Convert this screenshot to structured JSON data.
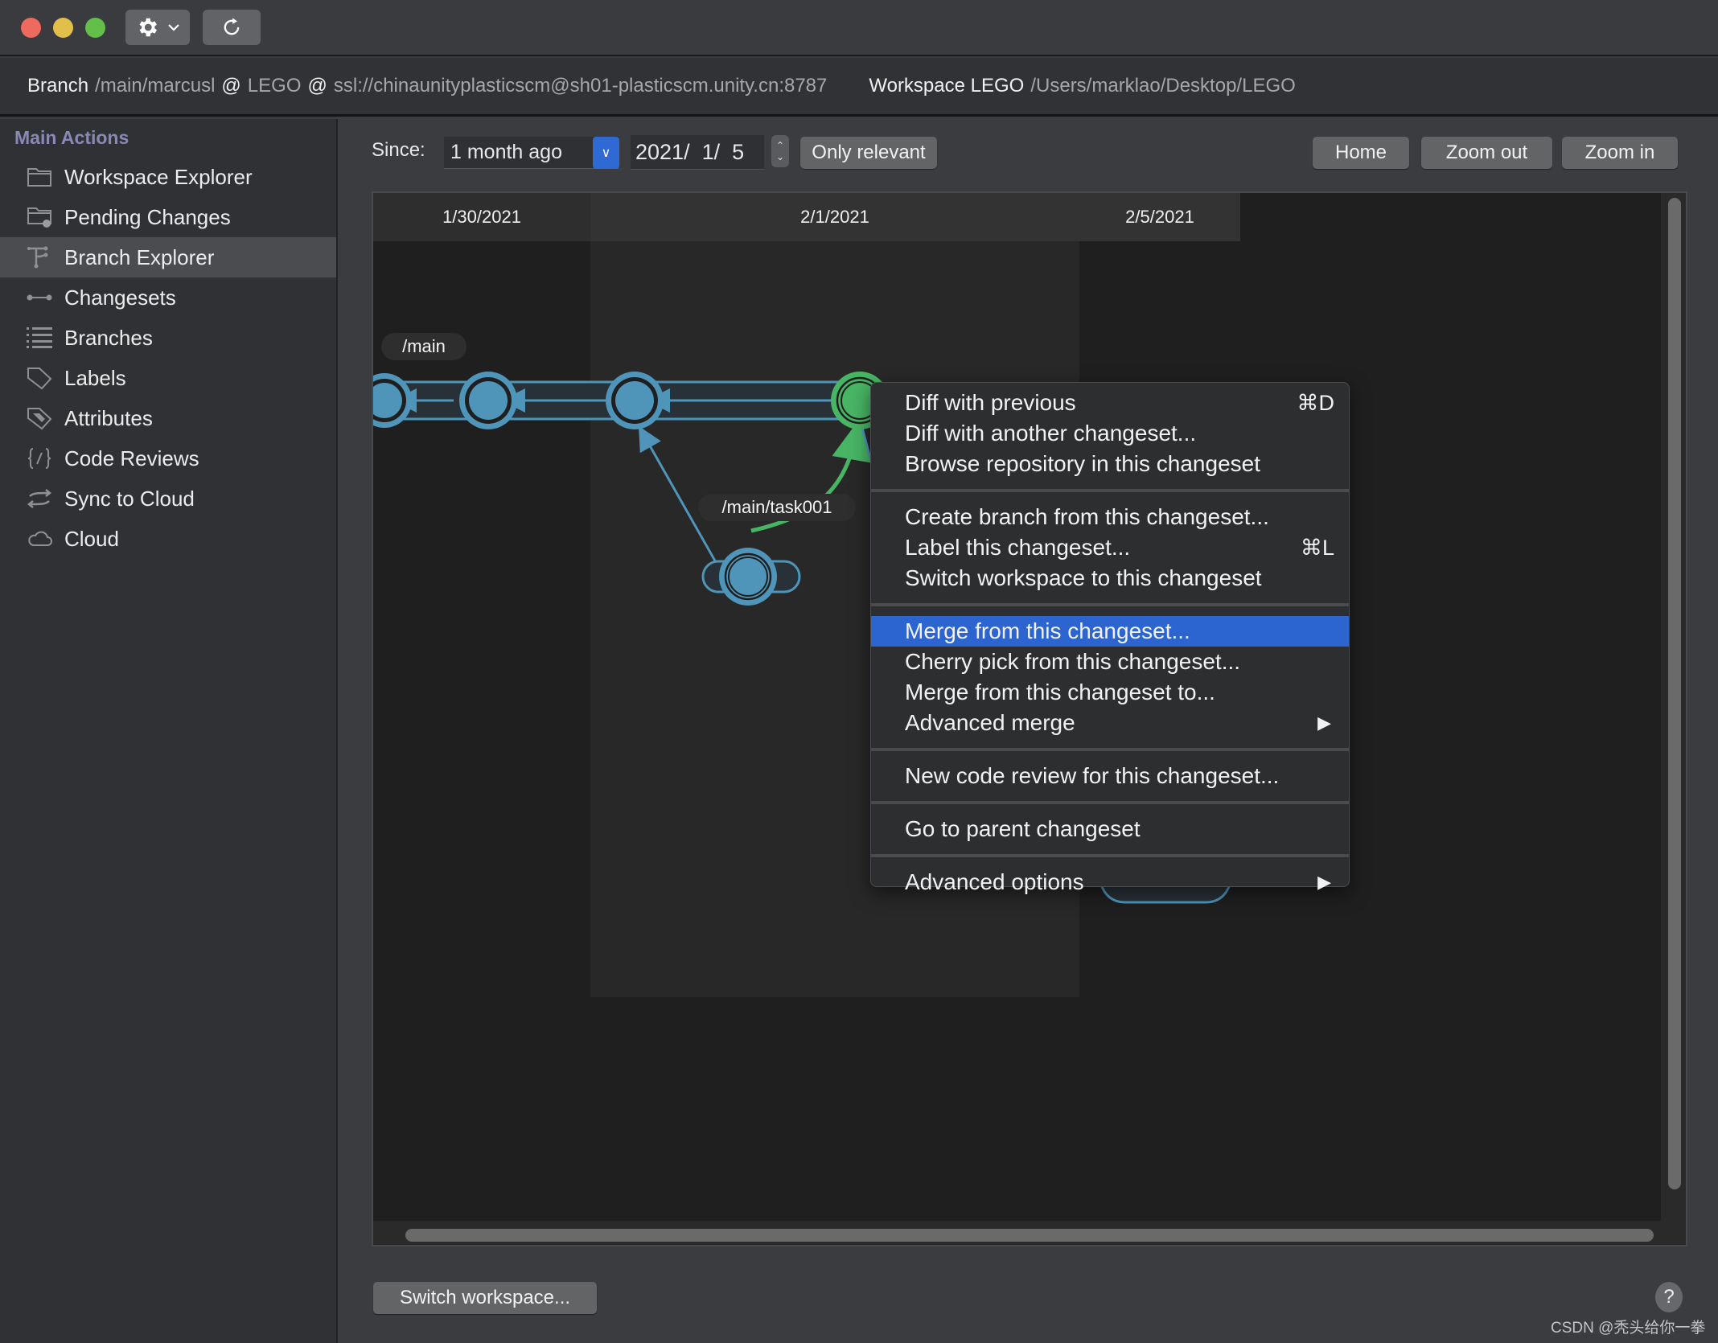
{
  "toolbar": {
    "gear_menu_icon": "gear-icon",
    "refresh_icon": "refresh-icon"
  },
  "header": {
    "branch_label": "Branch",
    "branch_path": "/main/marcusl",
    "at1": "@",
    "repo": "LEGO",
    "at2": "@",
    "server": "ssl://chinaunityplasticscm@sh01-plasticscm.unity.cn:8787",
    "workspace_label": "Workspace LEGO",
    "workspace_path": "/Users/marklao/Desktop/LEGO"
  },
  "sidebar": {
    "title": "Main Actions",
    "items": [
      {
        "label": "Workspace Explorer",
        "icon": "folder-icon"
      },
      {
        "label": "Pending Changes",
        "icon": "folder-pending-icon"
      },
      {
        "label": "Branch Explorer",
        "icon": "branch-explorer-icon",
        "active": true
      },
      {
        "label": "Changesets",
        "icon": "changesets-icon"
      },
      {
        "label": "Branches",
        "icon": "list-icon"
      },
      {
        "label": "Labels",
        "icon": "tag-icon"
      },
      {
        "label": "Attributes",
        "icon": "attribute-tag-icon"
      },
      {
        "label": "Code Reviews",
        "icon": "code-review-icon"
      },
      {
        "label": "Sync to Cloud",
        "icon": "sync-icon"
      },
      {
        "label": "Cloud",
        "icon": "cloud-icon"
      }
    ]
  },
  "filters": {
    "since_label": "Since:",
    "since_value": "1 month ago",
    "date_value": "2021/  1/  5",
    "only_relevant": "Only relevant",
    "home": "Home",
    "zoom_out": "Zoom out",
    "zoom_in": "Zoom in"
  },
  "branch_explorer": {
    "dates": [
      "1/30/2021",
      "2/1/2021",
      "2/5/2021"
    ],
    "branches": [
      {
        "name": "/main"
      },
      {
        "name": "/main/task001"
      }
    ],
    "colors": {
      "changeset": "#4f95ba",
      "selected_changeset": "#48b564",
      "merge_link": "#48b564"
    }
  },
  "context_menu": {
    "groups": [
      [
        {
          "label": "Diff with previous",
          "shortcut": "⌘D"
        },
        {
          "label": "Diff with another changeset..."
        },
        {
          "label": "Browse repository in this changeset"
        }
      ],
      [
        {
          "label": "Create branch from this changeset..."
        },
        {
          "label": "Label this changeset...",
          "shortcut": "⌘L"
        },
        {
          "label": "Switch workspace to this changeset"
        }
      ],
      [
        {
          "label": "Merge from this changeset...",
          "highlighted": true
        },
        {
          "label": "Cherry pick from this changeset..."
        },
        {
          "label": "Merge from this changeset to..."
        },
        {
          "label": "Advanced merge",
          "submenu": true
        }
      ],
      [
        {
          "label": "New code review for this changeset..."
        }
      ],
      [
        {
          "label": "Go to parent changeset"
        }
      ],
      [
        {
          "label": "Advanced options",
          "submenu": true
        }
      ]
    ],
    "highlight_color": "#2c65d0"
  },
  "footer": {
    "switch_workspace": "Switch workspace...",
    "help": "?",
    "watermark": "CSDN @秃头给你一拳"
  }
}
